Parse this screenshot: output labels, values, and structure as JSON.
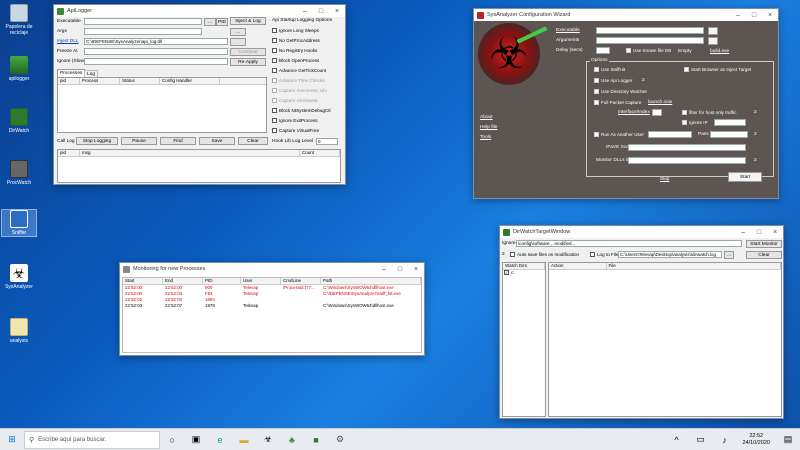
{
  "desktop": {
    "icons": [
      {
        "label": "Papelera de reciclaje",
        "color": "#c9d6e3"
      },
      {
        "label": "apilogger",
        "color": "#3a8a3a"
      },
      {
        "label": "DirWatch",
        "color": "#2f7a2f"
      },
      {
        "label": "ProcWatch",
        "color": "#555555"
      },
      {
        "label": "Sniffer",
        "color": "#2b6cc4"
      },
      {
        "label": "SysAnalyzer",
        "color": "#ffffff"
      },
      {
        "label": "analysis",
        "color": "#f2e6b0"
      }
    ]
  },
  "apilogger": {
    "title": "ApiLogger",
    "labels": {
      "executable": "Executable",
      "args": "Args",
      "inject_dll": "Inject DLL",
      "freeze_at": "Freeze At",
      "ignore": "Ignore (Slow)",
      "log_level": "Hook Lib Log Level",
      "call_log": "Call Log"
    },
    "values": {
      "inject_dll": "C:\\IDEFENSE\\SysAnalyzer\\api_log.dll",
      "log_level": "0"
    },
    "buttons": {
      "browse": "...",
      "pid": "PID",
      "inject_log": "Inject & Log",
      "browse2": "...",
      "continue": "Continue",
      "reapply": "Re-Apply",
      "stop_logging": "Stop Logging",
      "pause": "Pause",
      "find": "Find",
      "save": "Save",
      "clear": "Clear"
    },
    "tabs": [
      "Processes",
      "Log"
    ],
    "proc_columns": [
      "pid",
      "Process",
      "Status",
      "Config Handler"
    ],
    "log_columns": [
      "pid",
      "msg",
      "Count"
    ],
    "options_title": "Api Startup Logging Options",
    "options": [
      {
        "label": "Ignore Long Sleeps",
        "disabled": false
      },
      {
        "label": "No GetProcAddress",
        "disabled": false
      },
      {
        "label": "No Registry Hooks",
        "disabled": false
      },
      {
        "label": "Block OpenProcess",
        "disabled": false
      },
      {
        "label": "Advance GetTickCount",
        "disabled": false
      },
      {
        "label": "Advance Time Checks",
        "disabled": true
      },
      {
        "label": "Capture mem/resrc info",
        "disabled": true
      },
      {
        "label": "Capture UnViewed",
        "disabled": true
      },
      {
        "label": "Block NtSystemDebugCtl",
        "disabled": false
      },
      {
        "label": "Ignore ExitProcess",
        "disabled": false
      },
      {
        "label": "Capture VirtualFree",
        "disabled": false
      }
    ]
  },
  "sysanalyzer": {
    "title": "SysAnalyzer Configuration Wizard",
    "labels": {
      "executable": "Executable",
      "arguments": "Arguments",
      "delay": "Delay (secs)",
      "empty": "Empty",
      "build": "build.exe",
      "options": "Options",
      "interface_ip": "Interface/Index",
      "launch_now": "launch now",
      "pass": "Pass",
      "ie_scan": "IFaVE Scan",
      "monitor_dlls": "Monitor DLLs in",
      "about": "About",
      "help_file": "Help file",
      "tools": "Tools",
      "skip": "Skip"
    },
    "values": {
      "delay": "30",
      "interface": "1",
      "user": "Administrador",
      "ie_scan": "explorer.exe,iexplore.exe",
      "monitor_dlls": "explorer.exe,svchost.exe,firefox.exe,dll"
    },
    "checks": {
      "use_known_db": "Use Known file DB",
      "use_sniffhit": "Use SniffHit",
      "use_api_logger": "Use Api Logger",
      "use_dir_watcher": "Use Directory Watcher",
      "full_packet": "Full Packet Capture",
      "run_as_other": "Run As Another User",
      "start_browser": "Start Browser as Inject Target",
      "filter_host": "filter for host only traffic",
      "ignore_ip": "Ignore IP"
    },
    "nums": {
      "n1": "2",
      "n2": "2",
      "n3": "2",
      "n4": "2"
    },
    "start": "Start"
  },
  "monitoring": {
    "title": "Monitoring for new Processes",
    "columns": [
      "Start",
      "End",
      "PID",
      "User",
      "CmdLine",
      "Path"
    ],
    "rows": [
      {
        "start": "22:52:00",
        "end": "22:52:00",
        "pid": "900",
        "user": "Televap",
        "cmd": "/Processid:{77...",
        "path": "C:\\Windows\\SysWOW64\\dllhost.exe",
        "red": true
      },
      {
        "start": "22:52:00",
        "end": "22:52:03",
        "pid": "F84",
        "user": "Televap",
        "cmd": "",
        "path": "C:\\IDEFENSE\\SysAnalyzer\\sniff_hit.exe",
        "red": true
      },
      {
        "start": "22:52:02",
        "end": "22:52:03",
        "pid": "1694",
        "user": "",
        "cmd": "",
        "path": "",
        "red": true
      },
      {
        "start": "22:52:03",
        "end": "22:52:07",
        "pid": "1978",
        "user": "Televap",
        "cmd": "",
        "path": "C:\\Windows\\SysWOW64\\dllhost.exe",
        "red": false
      }
    ]
  },
  "dirwatch": {
    "title": "DirWatchTargetWindow",
    "ignore_label": "Ignore",
    "ignore_value": "\\config\\software , .modified...",
    "start_monitor": "Start Monitor",
    "num": "2",
    "auto_save": "Auto save files on modification",
    "log_to_file": "Log to File",
    "log_path": "C:\\Users\\Televap\\Desktop\\analysis\\\\dirwatch.log",
    "browse": "...",
    "clear": "Clear",
    "watch_dirs_header": "Watch Dirs",
    "watch_dir": "c:",
    "action_header": "Action",
    "file_header": "File"
  },
  "taskbar": {
    "search_placeholder": "Escribe aquí para buscar.",
    "time": "22:52",
    "date": "24/10/2020"
  }
}
